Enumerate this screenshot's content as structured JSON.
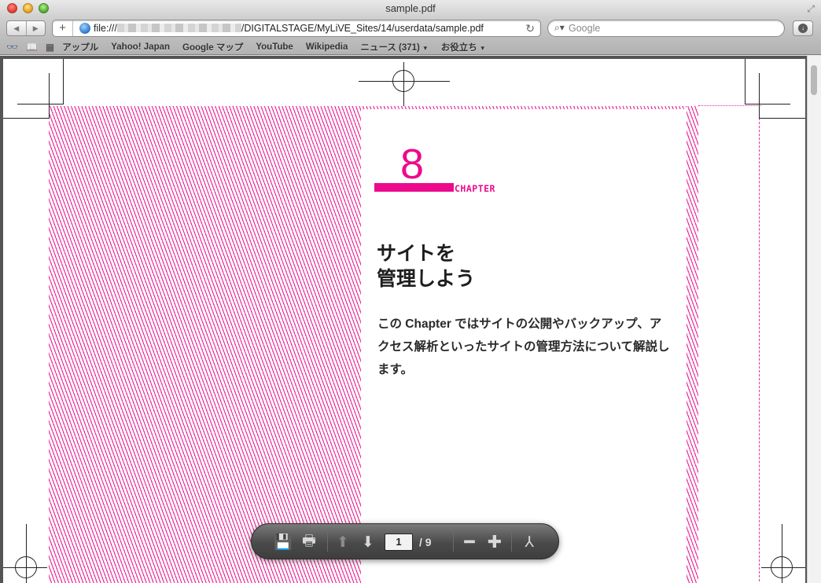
{
  "window": {
    "title": "sample.pdf"
  },
  "toolbar": {
    "back_icon": "back-arrow-icon",
    "forward_icon": "forward-arrow-icon",
    "add_icon": "plus-icon",
    "url_prefix": "file:///",
    "url_suffix": "/DIGITALSTAGE/MyLiVE_Sites/14/userdata/sample.pdf",
    "search_placeholder": "Google"
  },
  "bookmarks": {
    "items": [
      {
        "label": "アップル"
      },
      {
        "label": "Yahoo! Japan"
      },
      {
        "label": "Google マップ"
      },
      {
        "label": "YouTube"
      },
      {
        "label": "Wikipedia"
      },
      {
        "label": "ニュース (371)",
        "menu": true
      },
      {
        "label": "お役立ち",
        "menu": true
      }
    ]
  },
  "pdf": {
    "chapter_number": "8",
    "chapter_label": "CHAPTER",
    "heading_line1": "サイトを",
    "heading_line2": "管理しよう",
    "lead_text": "この Chapter ではサイトの公開やバックアップ、アクセス解析といったサイトの管理方法について解説します。",
    "accent_color": "#ec0a8c"
  },
  "hud": {
    "current_page": "1",
    "total_pages": "/ 9"
  }
}
